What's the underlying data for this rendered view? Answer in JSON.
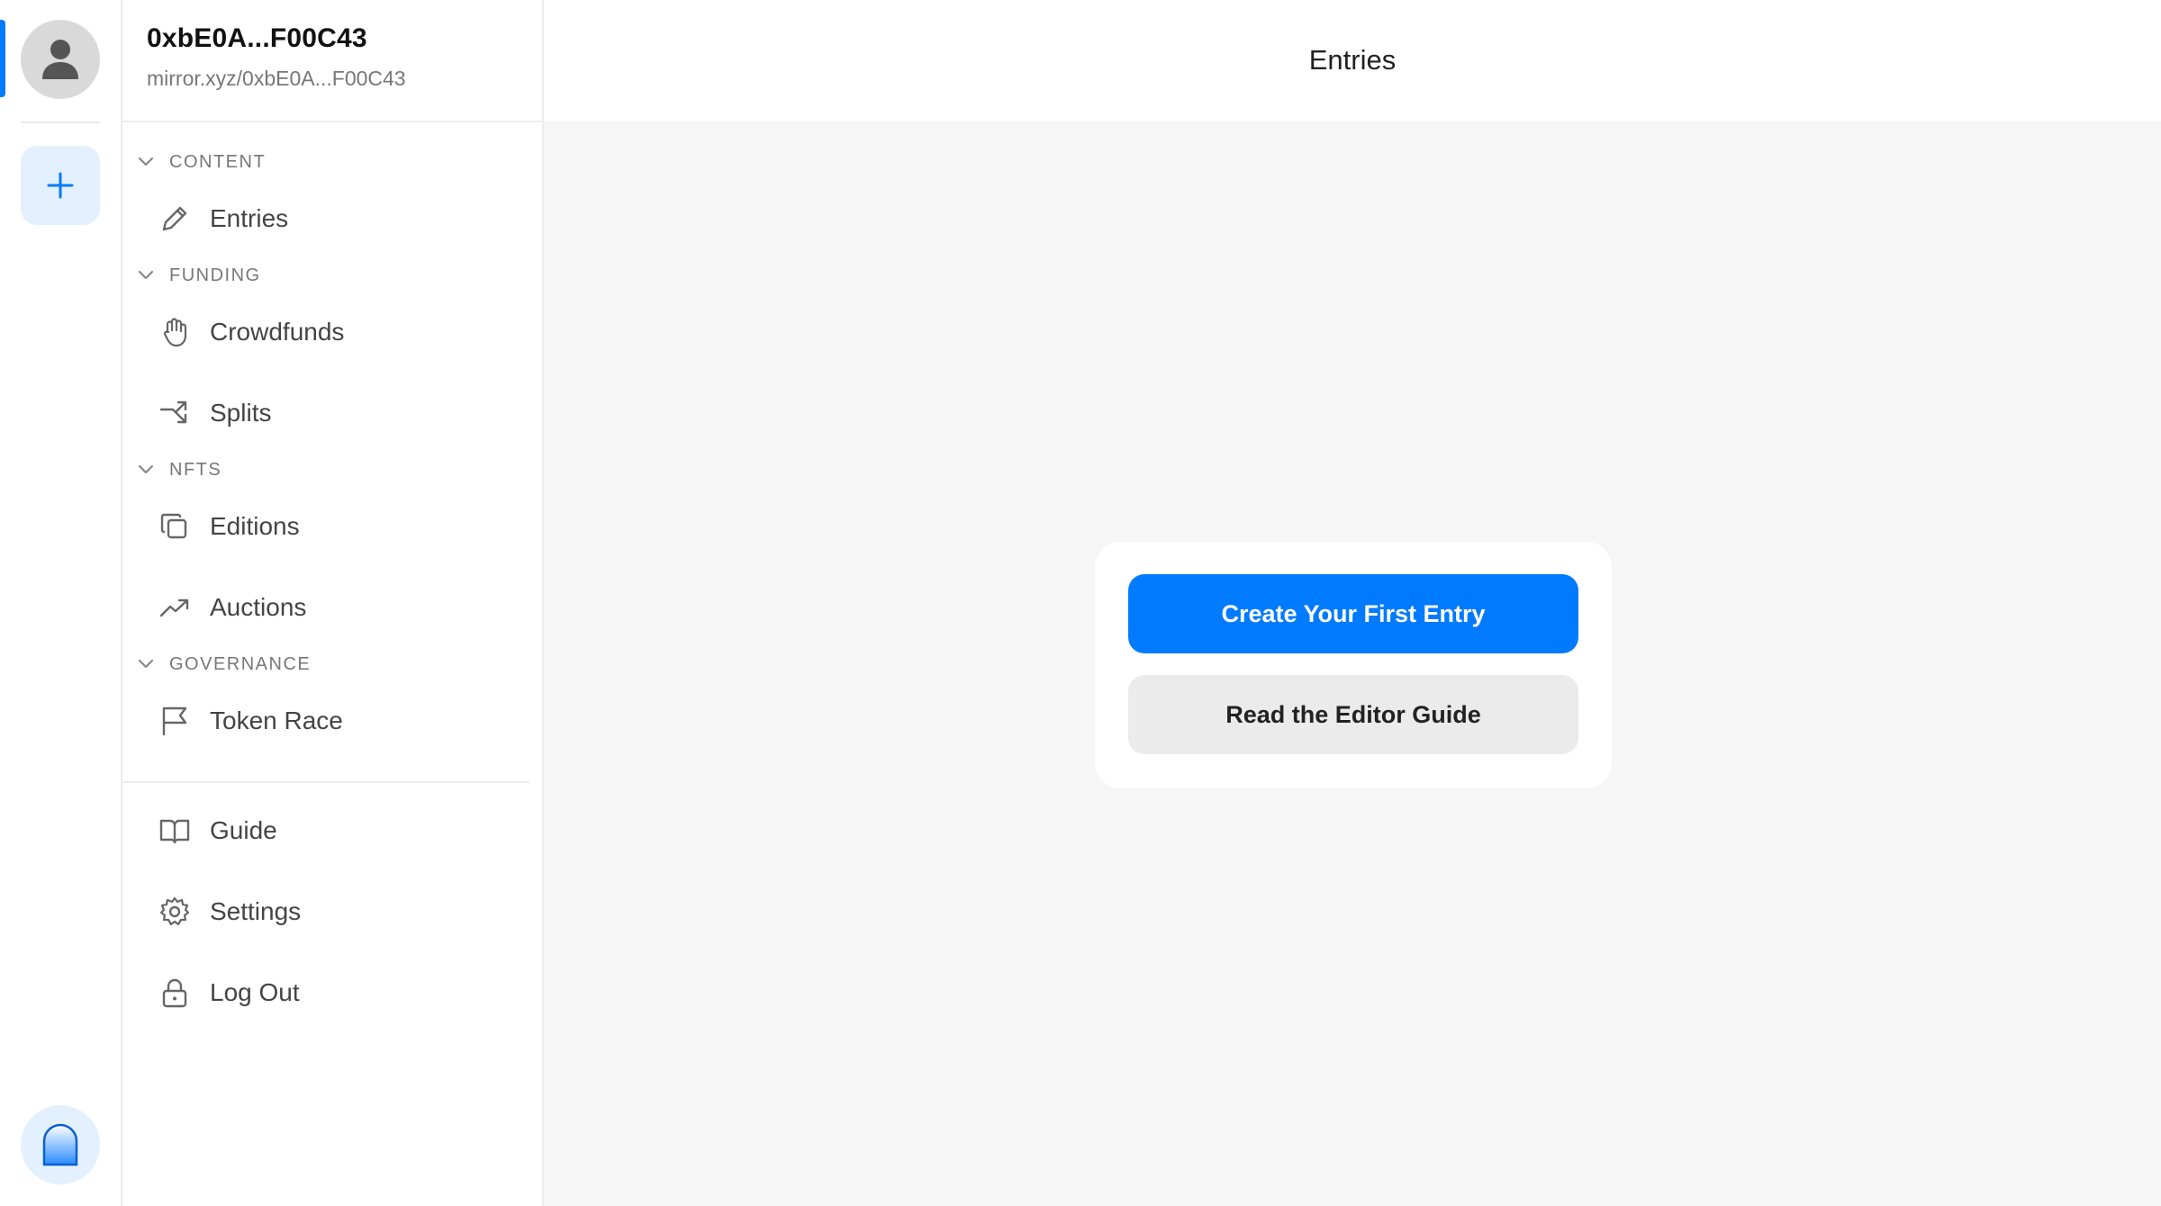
{
  "profile": {
    "name": "0xbE0A...F00C43",
    "url": "mirror.xyz/0xbE0A...F00C43"
  },
  "header": {
    "title": "Entries"
  },
  "sections": {
    "content": {
      "label": "CONTENT",
      "items": [
        {
          "label": "Entries",
          "icon": "pencil-icon"
        }
      ]
    },
    "funding": {
      "label": "FUNDING",
      "items": [
        {
          "label": "Crowdfunds",
          "icon": "hand-icon"
        },
        {
          "label": "Splits",
          "icon": "split-arrows-icon"
        }
      ]
    },
    "nfts": {
      "label": "NFTS",
      "items": [
        {
          "label": "Editions",
          "icon": "copy-icon"
        },
        {
          "label": "Auctions",
          "icon": "trending-up-icon"
        }
      ]
    },
    "governance": {
      "label": "GOVERNANCE",
      "items": [
        {
          "label": "Token Race",
          "icon": "flag-icon"
        }
      ]
    }
  },
  "bottom_nav": [
    {
      "label": "Guide",
      "icon": "book-icon"
    },
    {
      "label": "Settings",
      "icon": "gear-icon"
    },
    {
      "label": "Log Out",
      "icon": "lock-icon"
    }
  ],
  "actions": {
    "primary": "Create Your First Entry",
    "secondary": "Read the Editor Guide"
  },
  "colors": {
    "accent": "#007aff",
    "accent_light": "#e3f1ff",
    "background": "#f6f6f6"
  }
}
